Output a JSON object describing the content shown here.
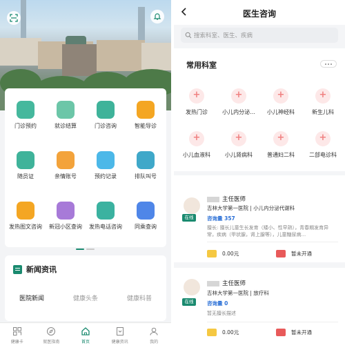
{
  "colors": {
    "accent": "#1a8a6f",
    "link": "#2a6fd6",
    "dept_icon": "#f08080"
  },
  "home": {
    "hero": {
      "scan_icon": "scan-icon",
      "bell_icon": "bell-icon"
    },
    "services": [
      {
        "label": "门诊预约",
        "icon": "calendar-icon",
        "color": "#45b89d"
      },
      {
        "label": "就诊结算",
        "icon": "invoice-icon",
        "color": "#6cc6a8"
      },
      {
        "label": "门诊咨询",
        "icon": "chat-icon",
        "color": "#3fb39a"
      },
      {
        "label": "智能导诊",
        "icon": "guide-icon",
        "color": "#f4a623"
      },
      {
        "label": "随员证",
        "icon": "badge-icon",
        "color": "#3fb39a"
      },
      {
        "label": "亲情账号",
        "icon": "heart-icon",
        "color": "#f3a33b"
      },
      {
        "label": "预约记录",
        "icon": "folder-icon",
        "color": "#4cb8e8"
      },
      {
        "label": "排队叫号",
        "icon": "hourglass-icon",
        "color": "#3fa8c9"
      },
      {
        "label": "发热图文咨询",
        "icon": "message-icon",
        "color": "#f4a623"
      },
      {
        "label": "新冠小区查询",
        "icon": "location-icon",
        "color": "#a77ad8"
      },
      {
        "label": "发热电话咨询",
        "icon": "phone-icon",
        "color": "#3bb2a0"
      },
      {
        "label": "同乘查询",
        "icon": "train-icon",
        "color": "#4f86e8"
      }
    ],
    "news": {
      "title": "新闻资讯",
      "tabs": [
        "医院新闻",
        "健康头条",
        "健康科普"
      ],
      "active_tab": "医院新闻"
    },
    "tabbar": [
      {
        "label": "健康卡",
        "icon": "card-icon"
      },
      {
        "label": "就医指南",
        "icon": "compass-icon"
      },
      {
        "label": "首页",
        "icon": "home-icon",
        "active": true
      },
      {
        "label": "健康资讯",
        "icon": "bookmark-icon"
      },
      {
        "label": "我的",
        "icon": "user-icon"
      }
    ]
  },
  "consult": {
    "title": "医生咨询",
    "search_placeholder": "搜索科室、医生、疾病",
    "common_title": "常用科室",
    "departments": [
      "发热门诊",
      "小儿内分泌...",
      "小儿神经科",
      "新生儿科",
      "小儿血液科",
      "小儿肾病科",
      "普通妇二科",
      "二部电诊科"
    ],
    "doctors": [
      {
        "title": "主任医师",
        "status": "在线",
        "hospital": "吉林大学第一医院 | 小儿内分泌代谢科",
        "consult_count": "咨询量 357",
        "desc": "擅长: 擅长儿童生长发育（矮小、性早熟），青春期发育异常，疾病（甲状腺，肾上腺等），儿童糖尿病...",
        "price": "0.00元",
        "video": "暂未开通"
      },
      {
        "title": "主任医师",
        "status": "在线",
        "hospital": "吉林大学第一医院 | 放疗科",
        "consult_count": "咨询量 0",
        "desc": "暂无擅长描述",
        "price": "0.00元",
        "video": "暂未开通"
      }
    ]
  }
}
